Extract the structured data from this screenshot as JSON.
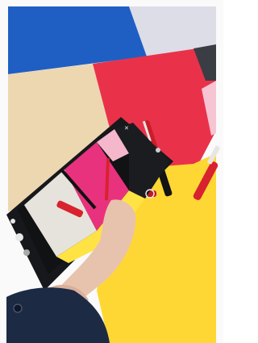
{
  "photo": {
    "description_icons": [
      "camera-capture-icon",
      "gallery-thumbnail-icon",
      "switch-camera-icon",
      "settings-gear-icon",
      "flash-icon",
      "close-icon"
    ],
    "colors": {
      "white_border": "#fafafa",
      "blue_paper": "#1f5fc4",
      "lavender_paper": "#dcdde6",
      "beige_paper": "#ecd7b1",
      "red_paper": "#e9324a",
      "dark_paper": "#3b3d45",
      "yellow_paper": "#ffd734",
      "pink_paper": "#f7c4d3",
      "phone_body": "#17181b",
      "phone_screen_pink": "#e9327d",
      "phone_screen_yellow": "#ffe345",
      "pen_red": "#d8222e",
      "sleeve_navy": "#1d2a44",
      "skin": "#e7c3ae"
    }
  }
}
